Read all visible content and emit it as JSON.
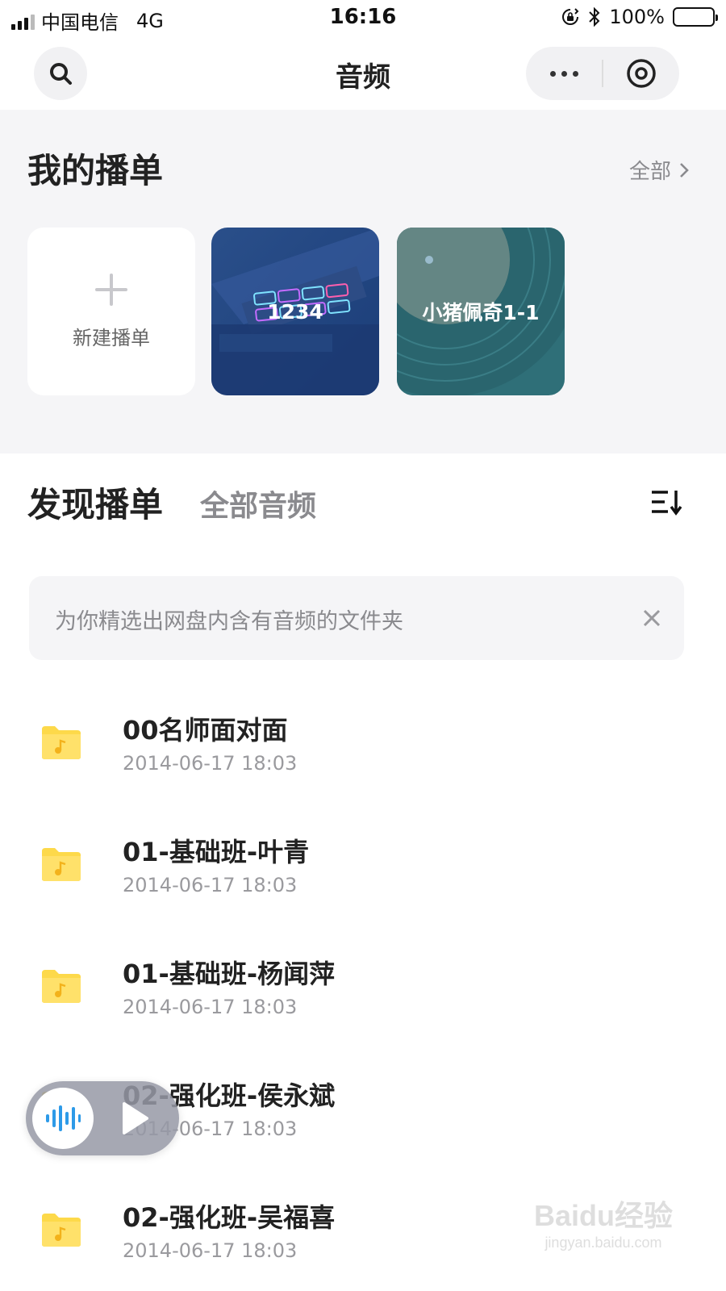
{
  "status_bar": {
    "carrier": "中国电信",
    "network": "4G",
    "time": "16:16",
    "battery": "100%"
  },
  "nav": {
    "title": "音频"
  },
  "my_playlists": {
    "title": "我的播单",
    "view_all": "全部",
    "new_label": "新建播单",
    "items": [
      {
        "name": "1234"
      },
      {
        "name": "小猪佩奇1-1"
      }
    ]
  },
  "discover": {
    "tab_active": "发现播单",
    "tab_other": "全部音频",
    "tip": "为你精选出网盘内含有音频的文件夹"
  },
  "folders": [
    {
      "name": "00名师面对面",
      "date": "2014-06-17 18:03"
    },
    {
      "name": "01-基础班-叶青",
      "date": "2014-06-17 18:03"
    },
    {
      "name": "01-基础班-杨闻萍",
      "date": "2014-06-17 18:03"
    },
    {
      "name": "02-强化班-侯永斌",
      "date": "2014-06-17 18:03"
    },
    {
      "name": "02-强化班-吴福喜",
      "date": "2014-06-17 18:03"
    }
  ],
  "watermark": {
    "logo": "Baidu经验",
    "url": "jingyan.baidu.com"
  },
  "colors": {
    "folder_yellow": "#FDD94A",
    "accent_blue": "#2D9AE8"
  }
}
